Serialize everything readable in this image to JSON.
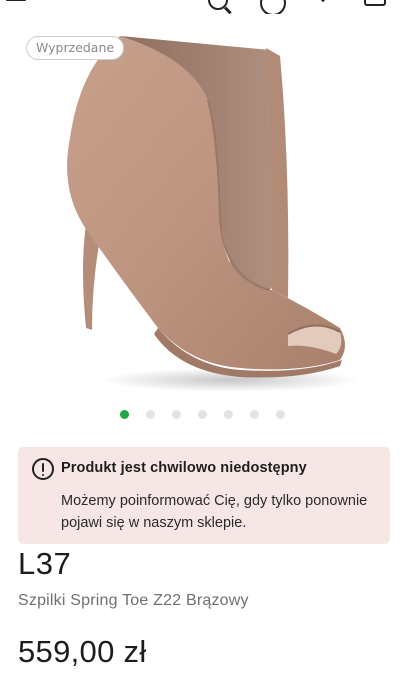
{
  "header": {
    "icons": [
      "menu-icon",
      "brand-icon",
      "search-icon",
      "account-icon",
      "heart-icon",
      "bag-icon"
    ],
    "brand_color": "#2dbb5d"
  },
  "gallery": {
    "badge": "Wyprzedane",
    "image": "beige-suede-peep-toe-stiletto-ankle-boot",
    "slide_count": 7,
    "active_slide": 1,
    "active_color": "#1fa648"
  },
  "notice": {
    "icon": "warning-icon",
    "title": "Produkt jest chwilowo niedostępny",
    "message": "Możemy poinformować Cię, gdy tylko ponownie pojawi się w naszym sklepie.",
    "background": "#f6e7e6"
  },
  "product": {
    "brand": "L37",
    "name": "Szpilki Spring Toe Z22 Brązowy",
    "price": "559,00 zł"
  }
}
